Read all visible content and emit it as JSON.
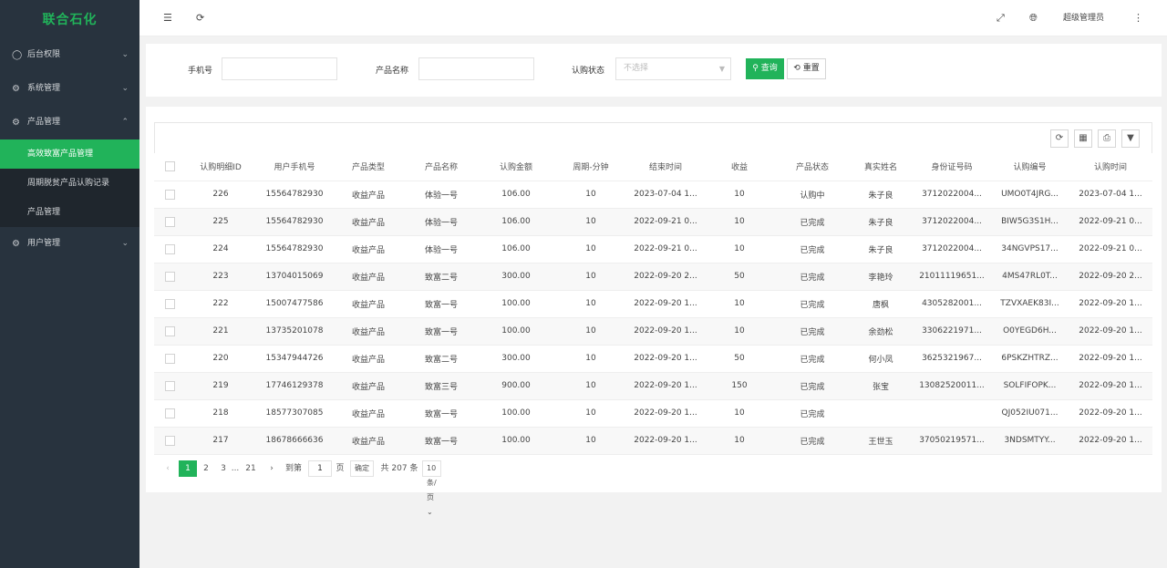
{
  "sidebar": {
    "brand": "联合石化",
    "menus": [
      {
        "label": "后台权限",
        "icon": "user-icon"
      },
      {
        "label": "系统管理",
        "icon": "gear-icon"
      },
      {
        "label": "产品管理",
        "icon": "gear-icon"
      },
      {
        "label": "用户管理",
        "icon": "gear-icon"
      }
    ],
    "product_submenu": [
      "高效致富产品管理",
      "周期脱贫产品认购记录",
      "产品管理"
    ]
  },
  "header": {
    "user": "超级管理员"
  },
  "search": {
    "phone_label": "手机号",
    "phone_value": "",
    "product_label": "产品名称",
    "product_value": "",
    "status_label": "认购状态",
    "status_placeholder": "不选择",
    "search_btn": "查询",
    "reset_btn": "重置"
  },
  "table": {
    "columns": [
      "认购明细ID",
      "用户手机号",
      "产品类型",
      "产品名称",
      "认购金额",
      "周期-分钟",
      "结束时间",
      "收益",
      "产品状态",
      "真实姓名",
      "身份证号码",
      "认购编号",
      "认购时间"
    ],
    "rows": [
      [
        "226",
        "15564782930",
        "收益产品",
        "体验一号",
        "106.00",
        "10",
        "2023-07-04 1...",
        "10",
        "认购中",
        "朱子良",
        "3712022004...",
        "UMO0T4JRG...",
        "2023-07-04 1..."
      ],
      [
        "225",
        "15564782930",
        "收益产品",
        "体验一号",
        "106.00",
        "10",
        "2022-09-21 0...",
        "10",
        "已完成",
        "朱子良",
        "3712022004...",
        "BIW5G3S1H...",
        "2022-09-21 0..."
      ],
      [
        "224",
        "15564782930",
        "收益产品",
        "体验一号",
        "106.00",
        "10",
        "2022-09-21 0...",
        "10",
        "已完成",
        "朱子良",
        "3712022004...",
        "34NGVPS17...",
        "2022-09-21 0..."
      ],
      [
        "223",
        "13704015069",
        "收益产品",
        "致富二号",
        "300.00",
        "10",
        "2022-09-20 2...",
        "50",
        "已完成",
        "李艳玲",
        "21011119651...",
        "4MS47RL0T...",
        "2022-09-20 2..."
      ],
      [
        "222",
        "15007477586",
        "收益产品",
        "致富一号",
        "100.00",
        "10",
        "2022-09-20 1...",
        "10",
        "已完成",
        "唐枫",
        "4305282001...",
        "TZVXAEK83I...",
        "2022-09-20 1..."
      ],
      [
        "221",
        "13735201078",
        "收益产品",
        "致富一号",
        "100.00",
        "10",
        "2022-09-20 1...",
        "10",
        "已完成",
        "余劲松",
        "3306221971...",
        "O0YEGD6H...",
        "2022-09-20 1..."
      ],
      [
        "220",
        "15347944726",
        "收益产品",
        "致富二号",
        "300.00",
        "10",
        "2022-09-20 1...",
        "50",
        "已完成",
        "何小凤",
        "3625321967...",
        "6PSKZHTRZ...",
        "2022-09-20 1..."
      ],
      [
        "219",
        "17746129378",
        "收益产品",
        "致富三号",
        "900.00",
        "10",
        "2022-09-20 1...",
        "150",
        "已完成",
        "张宝",
        "13082520011...",
        "SOLFIFOPK...",
        "2022-09-20 1..."
      ],
      [
        "218",
        "18577307085",
        "收益产品",
        "致富一号",
        "100.00",
        "10",
        "2022-09-20 1...",
        "10",
        "已完成",
        "",
        "",
        "QJ052IU071...",
        "2022-09-20 1..."
      ],
      [
        "217",
        "18678666636",
        "收益产品",
        "致富一号",
        "100.00",
        "10",
        "2022-09-20 1...",
        "10",
        "已完成",
        "王世玉",
        "37050219571...",
        "3NDSMTYY...",
        "2022-09-20 1..."
      ]
    ]
  },
  "pager": {
    "pages": [
      "1",
      "2",
      "3",
      "...",
      "21"
    ],
    "goto_label": "到第",
    "goto_value": "1",
    "page_unit": "页",
    "confirm": "确定",
    "total": "共 207 条",
    "page_size": "10 条/页"
  }
}
